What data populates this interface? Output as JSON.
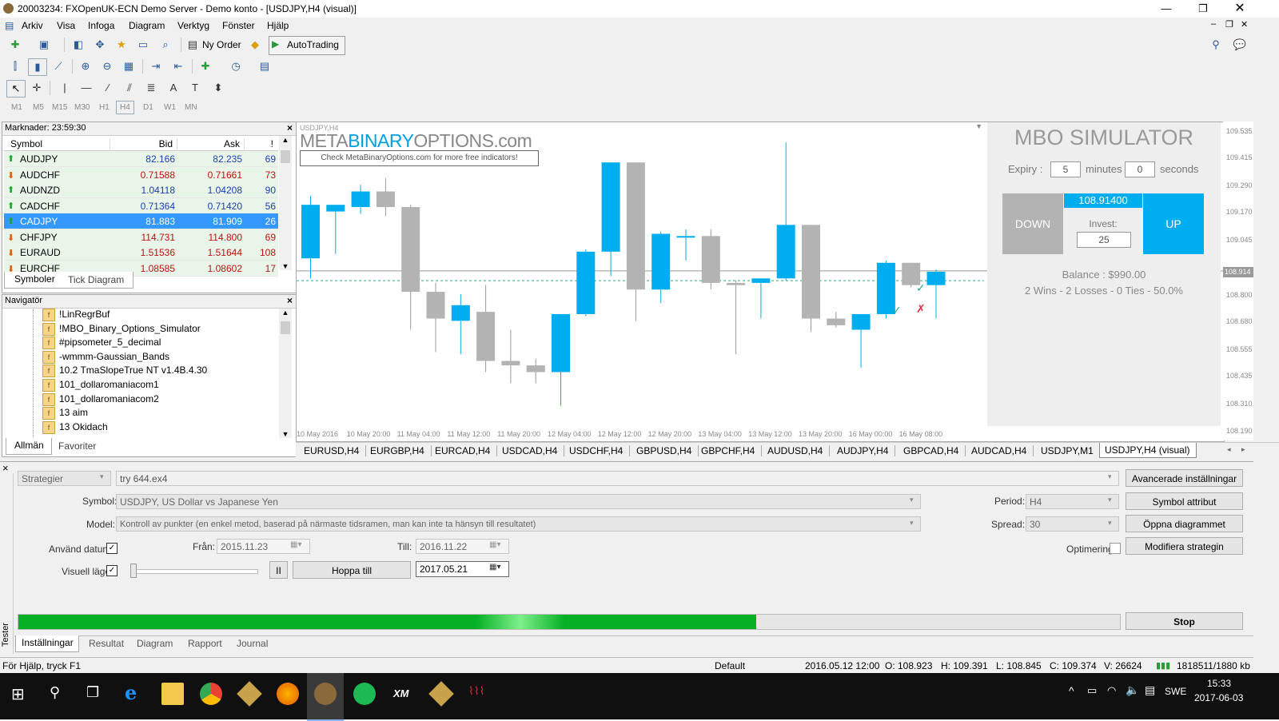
{
  "window": {
    "title": "20003234: FXOpenUK-ECN Demo Server - Demo konto - [USDJPY,H4 (visual)]"
  },
  "menu": [
    "Arkiv",
    "Visa",
    "Infoga",
    "Diagram",
    "Verktyg",
    "Fönster",
    "Hjälp"
  ],
  "toolbar": {
    "new_order": "Ny Order",
    "autotrading": "AutoTrading"
  },
  "timeframes": [
    "M1",
    "M5",
    "M15",
    "M30",
    "H1",
    "H4",
    "D1",
    "W1",
    "MN"
  ],
  "market": {
    "title": "Marknader: 23:59:30",
    "headers": {
      "symbol": "Symbol",
      "bid": "Bid",
      "ask": "Ask",
      "spread": "!"
    },
    "rows": [
      {
        "symbol": "AUDJPY",
        "bid": "82.166",
        "ask": "82.235",
        "spread": "69",
        "dir": "up"
      },
      {
        "symbol": "AUDCHF",
        "bid": "0.71588",
        "ask": "0.71661",
        "spread": "73",
        "dir": "down"
      },
      {
        "symbol": "AUDNZD",
        "bid": "1.04118",
        "ask": "1.04208",
        "spread": "90",
        "dir": "up"
      },
      {
        "symbol": "CADCHF",
        "bid": "0.71364",
        "ask": "0.71420",
        "spread": "56",
        "dir": "up"
      },
      {
        "symbol": "CADJPY",
        "bid": "81.883",
        "ask": "81.909",
        "spread": "26",
        "dir": "up"
      },
      {
        "symbol": "CHFJPY",
        "bid": "114.731",
        "ask": "114.800",
        "spread": "69",
        "dir": "down"
      },
      {
        "symbol": "EURAUD",
        "bid": "1.51536",
        "ask": "1.51644",
        "spread": "108",
        "dir": "down"
      },
      {
        "symbol": "EURCHF",
        "bid": "1.08585",
        "ask": "1.08602",
        "spread": "17",
        "dir": "down"
      }
    ],
    "selected_index": 4,
    "tabs": [
      "Symboler",
      "Tick Diagram"
    ]
  },
  "navigator": {
    "title": "Navigatör",
    "items": [
      "!LinRegrBuf",
      "!MBO_Binary_Options_Simulator",
      "#pipsometer_5_decimal",
      "-wmmm-Gaussian_Bands",
      "10.2 TmaSlopeTrue NT v1.4B.4.30",
      "101_dollaromaniacom1",
      "101_dollaromaniacom2",
      "13 aim",
      "13 Okidach"
    ],
    "tabs": [
      "Allmän",
      "Favoriter"
    ]
  },
  "chart": {
    "symbol_label": "USDJPY,H4",
    "logo_part1": "META",
    "logo_part2": "BINARY",
    "logo_part3": "OPTIONS.com",
    "logo_link": "Check MetaBinaryOptions.com for more free indicators!",
    "current_price_label": "108.914",
    "price_labels": [
      "109.535",
      "109.415",
      "109.290",
      "109.170",
      "109.045",
      "108.800",
      "108.680",
      "108.555",
      "108.435",
      "108.310",
      "108.190"
    ],
    "time_labels": [
      "10 May 2016",
      "10 May 20:00",
      "11 May 04:00",
      "11 May 12:00",
      "11 May 20:00",
      "12 May 04:00",
      "12 May 12:00",
      "12 May 20:00",
      "13 May 04:00",
      "13 May 12:00",
      "13 May 20:00",
      "16 May 00:00",
      "16 May 08:00"
    ],
    "colors": {
      "up": "#00aeef",
      "down": "#b3b3b3",
      "wick_up": "#00aeef",
      "wick_down": "#9a9a9a"
    },
    "candles": [
      {
        "o": 108.97,
        "h": 109.25,
        "l": 108.88,
        "c": 109.21
      },
      {
        "o": 109.18,
        "h": 109.19,
        "l": 108.99,
        "c": 109.21
      },
      {
        "o": 109.2,
        "h": 109.3,
        "l": 109.17,
        "c": 109.27
      },
      {
        "o": 109.27,
        "h": 109.33,
        "l": 109.16,
        "c": 109.2
      },
      {
        "o": 109.2,
        "h": 109.21,
        "l": 108.65,
        "c": 108.82
      },
      {
        "o": 108.82,
        "h": 108.86,
        "l": 108.55,
        "c": 108.7
      },
      {
        "o": 108.69,
        "h": 108.81,
        "l": 108.54,
        "c": 108.76
      },
      {
        "o": 108.73,
        "h": 108.85,
        "l": 108.46,
        "c": 108.51
      },
      {
        "o": 108.51,
        "h": 108.65,
        "l": 108.41,
        "c": 108.49
      },
      {
        "o": 108.49,
        "h": 108.52,
        "l": 108.41,
        "c": 108.46
      },
      {
        "o": 108.46,
        "h": 108.72,
        "l": 108.31,
        "c": 108.72
      },
      {
        "o": 108.72,
        "h": 109.01,
        "l": 108.71,
        "c": 109.0
      },
      {
        "o": 109.0,
        "h": 109.4,
        "l": 108.89,
        "c": 109.4
      },
      {
        "o": 109.4,
        "h": 109.4,
        "l": 108.69,
        "c": 108.83
      },
      {
        "o": 108.83,
        "h": 109.09,
        "l": 108.77,
        "c": 109.08
      },
      {
        "o": 109.07,
        "h": 109.1,
        "l": 108.96,
        "c": 109.07
      },
      {
        "o": 109.07,
        "h": 109.1,
        "l": 108.83,
        "c": 108.86
      },
      {
        "o": 108.86,
        "h": 108.87,
        "l": 108.54,
        "c": 108.85
      },
      {
        "o": 108.86,
        "h": 108.88,
        "l": 108.7,
        "c": 108.88
      },
      {
        "o": 108.88,
        "h": 109.49,
        "l": 108.87,
        "c": 109.12
      },
      {
        "o": 109.12,
        "h": 109.12,
        "l": 108.64,
        "c": 108.7
      },
      {
        "o": 108.7,
        "h": 108.73,
        "l": 108.66,
        "c": 108.67
      },
      {
        "o": 108.65,
        "h": 108.72,
        "l": 108.48,
        "c": 108.72
      },
      {
        "o": 108.72,
        "h": 108.96,
        "l": 108.7,
        "c": 108.95
      },
      {
        "o": 108.95,
        "h": 108.95,
        "l": 108.84,
        "c": 108.85
      },
      {
        "o": 108.85,
        "h": 108.92,
        "l": 108.7,
        "c": 108.91
      }
    ],
    "tabs": [
      "EURUSD,H4",
      "EURGBP,H4",
      "EURCAD,H4",
      "USDCAD,H4",
      "USDCHF,H4",
      "GBPUSD,H4",
      "GBPCHF,H4",
      "AUDUSD,H4",
      "AUDJPY,H4",
      "GBPCAD,H4",
      "AUDCAD,H4",
      "USDJPY,M1",
      "USDJPY,H4 (visual)"
    ]
  },
  "mbo": {
    "title": "MBO SIMULATOR",
    "expiry_label": "Expiry :",
    "expiry_minutes": "5",
    "minutes_label": "minutes",
    "expiry_seconds": "0",
    "seconds_label": "seconds",
    "down_label": "DOWN",
    "up_label": "UP",
    "price": "108.91400",
    "invest_label": "Invest:",
    "invest_value": "25",
    "balance": "Balance : $990.00",
    "stats": "2 Wins - 2 Losses - 0 Ties - 50.0%"
  },
  "tester": {
    "side_label": "Tester",
    "type_select": "Strategier",
    "expert": "try 644.ex4",
    "symbol_label": "Symbol:",
    "symbol_value": "USDJPY, US Dollar vs Japanese Yen",
    "model_label": "Model:",
    "model_value": "Kontroll av punkter (en enkel metod, baserad på närmaste tidsramen, man kan inte ta hänsyn till resultatet)",
    "use_date_label": "Använd datum",
    "from_label": "Från:",
    "from_value": "2015.11.23",
    "to_label": "Till:",
    "to_value": "2016.11.22",
    "visual_label": "Visuell läge",
    "pause_label": "II",
    "skip_label": "Hoppa till",
    "skip_date": "2017.05.21",
    "period_label": "Period:",
    "period_value": "H4",
    "spread_label": "Spread:",
    "spread_value": "30",
    "optimize_label": "Optimering",
    "btn_advanced": "Avancerade inställningar",
    "btn_symbol": "Symbol attribut",
    "btn_open_chart": "Öppna diagrammet",
    "btn_modify": "Modifiera strategin",
    "btn_stop": "Stop",
    "progress": 0.67,
    "tabs": [
      "Inställningar",
      "Resultat",
      "Diagram",
      "Rapport",
      "Journal"
    ]
  },
  "status": {
    "help": "För Hjälp, tryck F1",
    "profile": "Default",
    "datetime": "2016.05.12 12:00",
    "open": "O: 108.923",
    "high": "H: 109.391",
    "low": "L: 108.845",
    "close": "C: 109.374",
    "volume": "V: 26624",
    "traffic": "1818511/1880 kb"
  },
  "taskbar": {
    "language": "SWE",
    "time": "15:33",
    "date": "2017-06-03"
  }
}
